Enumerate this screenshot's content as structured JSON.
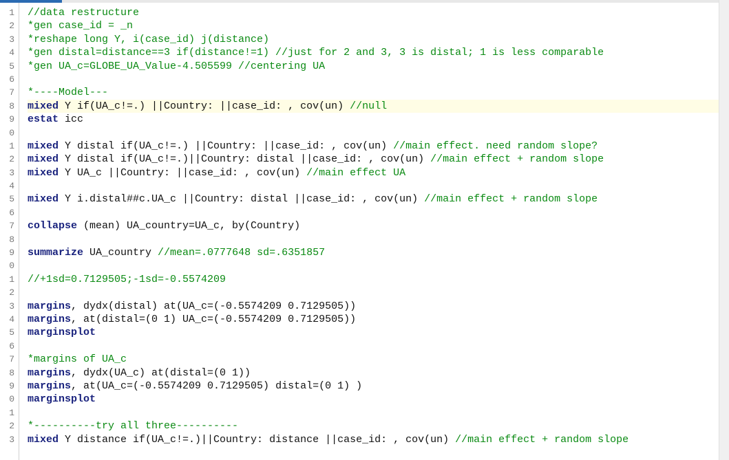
{
  "editor": {
    "first_line_number": 1,
    "highlighted_index": 7,
    "lines": [
      [
        {
          "cls": "tok-cmt",
          "t": "//data restructure"
        }
      ],
      [
        {
          "cls": "tok-cmt",
          "t": "*gen case_id = _n"
        }
      ],
      [
        {
          "cls": "tok-cmt",
          "t": "*reshape long Y, i(case_id) j(distance)"
        }
      ],
      [
        {
          "cls": "tok-cmt",
          "t": "*gen distal=distance==3 if(distance!=1) //just for 2 and 3, 3 is distal; 1 is less comparable"
        }
      ],
      [
        {
          "cls": "tok-cmt",
          "t": "*gen UA_c=GLOBE_UA_Value-4.505599 //centering UA"
        }
      ],
      [],
      [
        {
          "cls": "tok-cmt",
          "t": "*----Model---"
        }
      ],
      [
        {
          "cls": "tok-kw",
          "t": "mixed "
        },
        {
          "cls": "tok-txt",
          "t": "Y if(UA_c!=.) ||Country: ||case_id: , cov(un) "
        },
        {
          "cls": "tok-cmt",
          "t": "//null"
        }
      ],
      [
        {
          "cls": "tok-kw",
          "t": "estat "
        },
        {
          "cls": "tok-txt",
          "t": "icc"
        }
      ],
      [],
      [
        {
          "cls": "tok-kw",
          "t": "mixed "
        },
        {
          "cls": "tok-txt",
          "t": "Y distal if(UA_c!=.) ||Country: ||case_id: , cov(un) "
        },
        {
          "cls": "tok-cmt",
          "t": "//main effect. need random slope?"
        }
      ],
      [
        {
          "cls": "tok-kw",
          "t": "mixed "
        },
        {
          "cls": "tok-txt",
          "t": "Y distal if(UA_c!=.)||Country: distal ||case_id: , cov(un) "
        },
        {
          "cls": "tok-cmt",
          "t": "//main effect + random slope"
        }
      ],
      [
        {
          "cls": "tok-kw",
          "t": "mixed "
        },
        {
          "cls": "tok-txt",
          "t": "Y UA_c ||Country: ||case_id: , cov(un) "
        },
        {
          "cls": "tok-cmt",
          "t": "//main effect UA"
        }
      ],
      [],
      [
        {
          "cls": "tok-kw",
          "t": "mixed "
        },
        {
          "cls": "tok-txt",
          "t": "Y i.distal##c.UA_c ||Country: distal ||case_id: , cov(un) "
        },
        {
          "cls": "tok-cmt",
          "t": "//main effect + random slope"
        }
      ],
      [],
      [
        {
          "cls": "tok-kw",
          "t": "collapse "
        },
        {
          "cls": "tok-txt",
          "t": "(mean) UA_country=UA_c, by(Country)"
        }
      ],
      [],
      [
        {
          "cls": "tok-kw",
          "t": "summarize "
        },
        {
          "cls": "tok-txt",
          "t": "UA_country "
        },
        {
          "cls": "tok-cmt",
          "t": "//mean=.0777648 sd=.6351857"
        }
      ],
      [],
      [
        {
          "cls": "tok-cmt",
          "t": "//+1sd=0.7129505;-1sd=-0.5574209"
        }
      ],
      [],
      [
        {
          "cls": "tok-kw",
          "t": "margins"
        },
        {
          "cls": "tok-txt",
          "t": ", dydx(distal) at(UA_c=(-0.5574209 0.7129505))"
        }
      ],
      [
        {
          "cls": "tok-kw",
          "t": "margins"
        },
        {
          "cls": "tok-txt",
          "t": ", at(distal=(0 1) UA_c=(-0.5574209 0.7129505))"
        }
      ],
      [
        {
          "cls": "tok-kw",
          "t": "marginsplot"
        }
      ],
      [],
      [
        {
          "cls": "tok-cmt",
          "t": "*margins of UA_c"
        }
      ],
      [
        {
          "cls": "tok-kw",
          "t": "margins"
        },
        {
          "cls": "tok-txt",
          "t": ", dydx(UA_c) at(distal=(0 1))"
        }
      ],
      [
        {
          "cls": "tok-kw",
          "t": "margins"
        },
        {
          "cls": "tok-txt",
          "t": ", at(UA_c=(-0.5574209 0.7129505) distal=(0 1) )"
        }
      ],
      [
        {
          "cls": "tok-kw",
          "t": "marginsplot"
        }
      ],
      [],
      [
        {
          "cls": "tok-cmt",
          "t": "*----------try all three----------"
        }
      ],
      [
        {
          "cls": "tok-kw",
          "t": "mixed "
        },
        {
          "cls": "tok-txt",
          "t": "Y distance if(UA_c!=.)||Country: distance ||case_id: , cov(un) "
        },
        {
          "cls": "tok-cmt",
          "t": "//main effect + random slope"
        }
      ]
    ]
  }
}
